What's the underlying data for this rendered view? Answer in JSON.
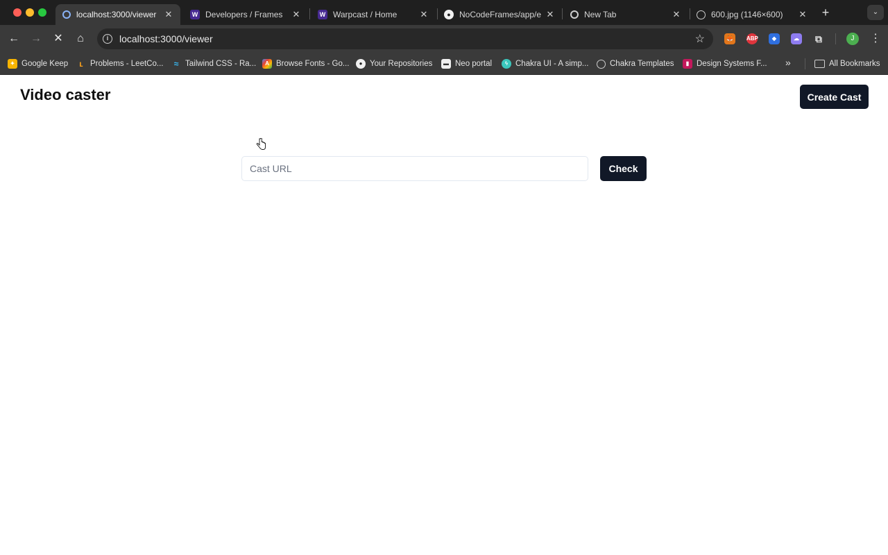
{
  "browser": {
    "tabs": [
      {
        "title": "localhost:3000/viewer",
        "icon": "loading-icon",
        "active": true
      },
      {
        "title": "Developers / Frames",
        "icon": "warpcast-icon"
      },
      {
        "title": "Warpcast / Home",
        "icon": "warpcast-icon"
      },
      {
        "title": "NoCodeFrames/app/ex",
        "icon": "github-icon"
      },
      {
        "title": "New Tab",
        "icon": "chrome-icon"
      },
      {
        "title": "600.jpg (1146×600)",
        "icon": "globe-icon"
      }
    ],
    "address": "localhost:3000/viewer",
    "profile_initial": "J",
    "bookmarks": [
      {
        "label": "Google Keep"
      },
      {
        "label": "Problems - LeetCo..."
      },
      {
        "label": "Tailwind CSS - Ra..."
      },
      {
        "label": "Browse Fonts - Go..."
      },
      {
        "label": "Your Repositories"
      },
      {
        "label": "Neo portal"
      },
      {
        "label": "Chakra UI - A simp..."
      },
      {
        "label": "Chakra Templates"
      },
      {
        "label": "Design Systems F..."
      }
    ],
    "all_bookmarks": "All Bookmarks"
  },
  "app": {
    "title": "Video caster",
    "create_label": "Create Cast",
    "input_placeholder": "Cast URL",
    "input_value": "",
    "check_label": "Check"
  },
  "colors": {
    "button_bg": "#111827",
    "browser_chrome": "#3a3a3a",
    "tabstrip": "#1f1f1f"
  }
}
